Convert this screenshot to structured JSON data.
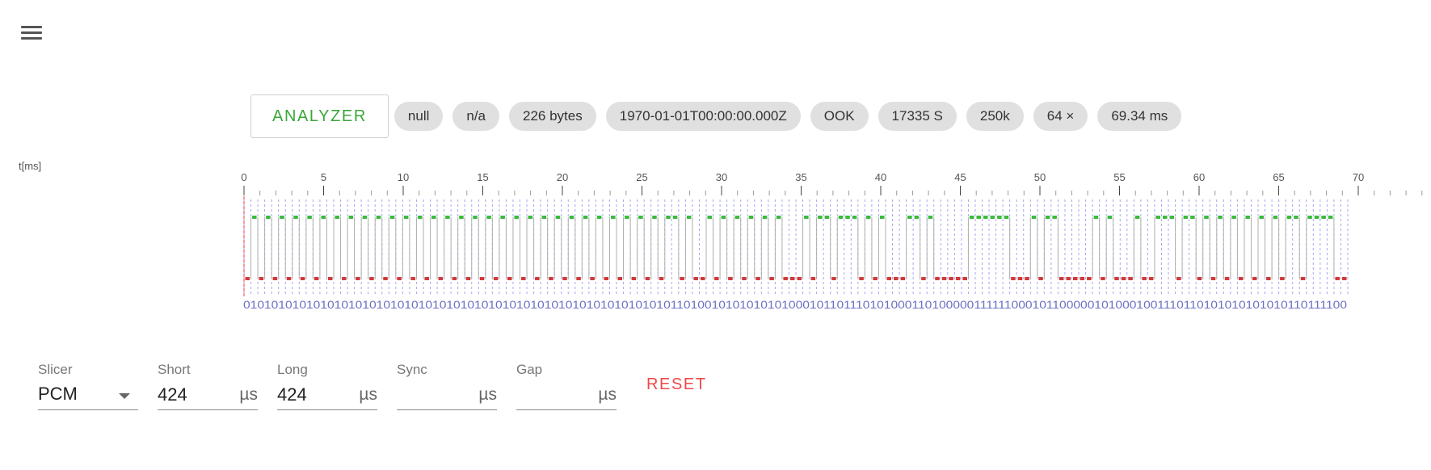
{
  "toolbar": {
    "menu_icon": "hamburger-menu-icon"
  },
  "header": {
    "analyzer_label": "ANALYZER",
    "chips": [
      "null",
      "n/a",
      "226 bytes",
      "1970-01-01T00:00:00.000Z",
      "OOK",
      "17335 S",
      "250k",
      "64 ×",
      "69.34 ms"
    ]
  },
  "signal": {
    "time_unit_label": "t[ms]",
    "axis_ticks": [
      "0",
      "5",
      "10",
      "15",
      "20",
      "25",
      "30",
      "35",
      "40",
      "45",
      "50",
      "55",
      "60",
      "65",
      "70"
    ],
    "axis_max_ms": 70,
    "duration_ms": 69.34,
    "pulse_width_us": 424,
    "bits": "0101010101010101010101010101010101010101010101010101010101010110100101010101010001011011101010001101000001111110001011000001010001001110110101010101010110111100",
    "colors": {
      "high": "#3dba3d",
      "low": "#d03a3a",
      "grid": "#a6a6f0",
      "cursor": "#ff9d9d"
    }
  },
  "controls": {
    "slicer": {
      "label": "Slicer",
      "value": "PCM"
    },
    "short": {
      "label": "Short",
      "value": "424",
      "unit": "µs"
    },
    "long": {
      "label": "Long",
      "value": "424",
      "unit": "µs"
    },
    "sync": {
      "label": "Sync",
      "value": "",
      "unit": "µs"
    },
    "gap": {
      "label": "Gap",
      "value": "",
      "unit": "µs"
    },
    "reset_label": "RESET"
  }
}
